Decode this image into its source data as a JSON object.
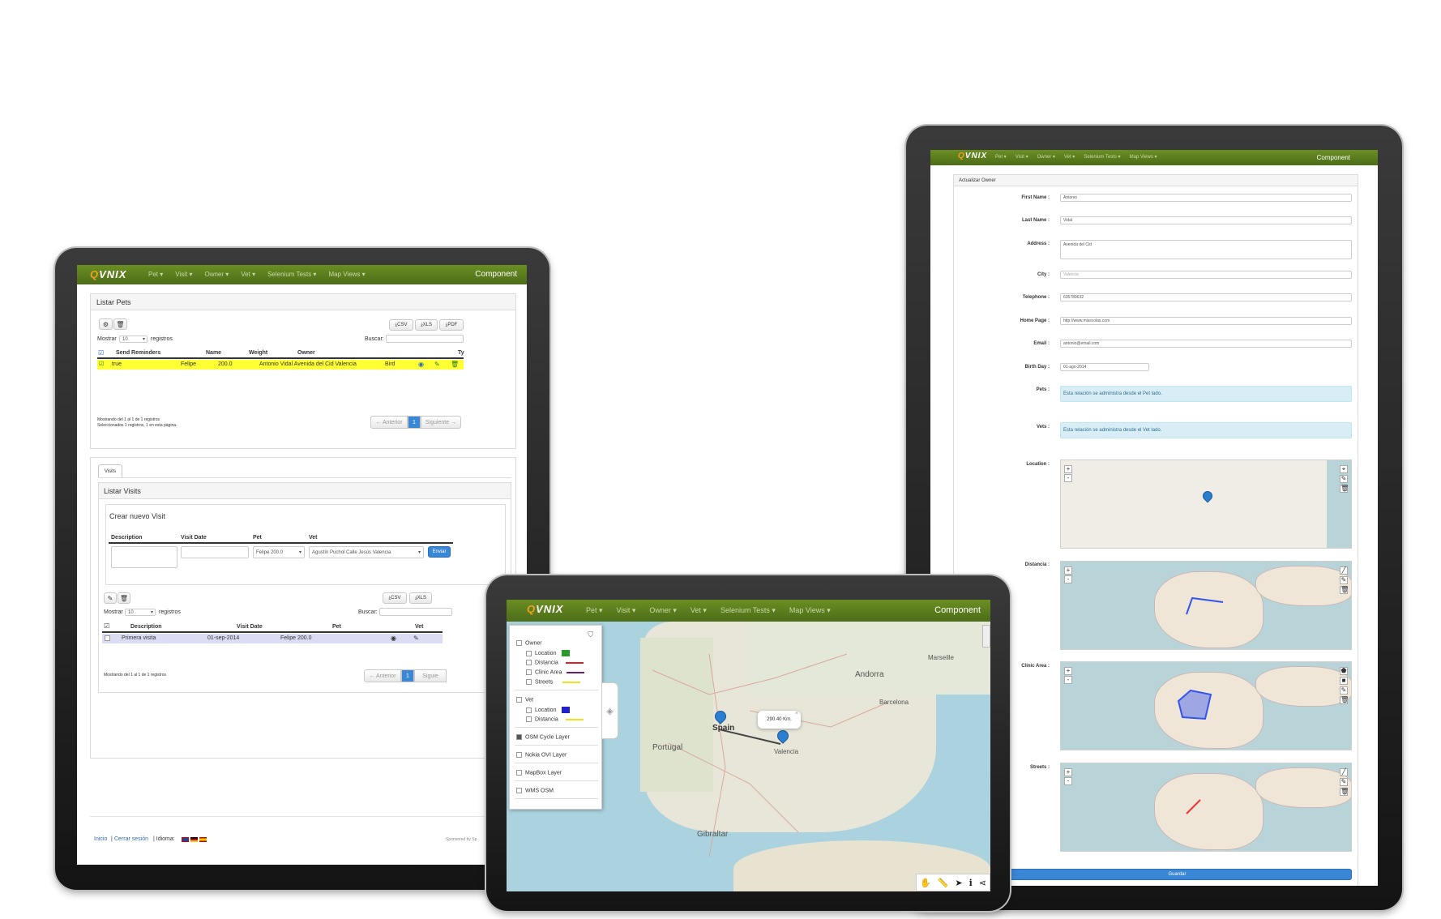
{
  "navbar": {
    "logo_prefix": "Q",
    "logo_text": "VNIX",
    "menus": [
      "Pet ▾",
      "Visit ▾",
      "Owner ▾",
      "Vet ▾",
      "Selenium Tests ▾",
      "Map Views ▾"
    ],
    "brand": "Component"
  },
  "pets": {
    "title": "Listar Pets",
    "export_buttons": [
      "⤓CSV",
      "⤓XLS",
      "⤓PDF"
    ],
    "show_label": "Mostrar",
    "show_value": "10",
    "records_label": "registros",
    "search_label": "Buscar:",
    "columns": [
      "Send Reminders",
      "Name",
      "Weight",
      "Owner",
      "Ty"
    ],
    "rows": [
      {
        "send_reminders": "true",
        "name": "Felipe",
        "weight": "200.0",
        "owner": "Antonio Vidal Avenida del Cid Valencia",
        "type": "Bird"
      }
    ],
    "info_line1": "Mostrando del 1 al 1 de 1 registros",
    "info_line2": "Seleccionados 1 registros, 1 en esta página.",
    "prev": "← Anterior",
    "page": "1",
    "next": "Siguiente →"
  },
  "visits": {
    "tab": "Visits",
    "title": "Listar Visits",
    "create_title": "Crear nuevo Visit",
    "form_labels": [
      "Description",
      "Visit Date",
      "Pet",
      "Vet"
    ],
    "pet_value": "Felipe 200.0",
    "vet_value": "Agustín Puchol Calle Jesús Valencia",
    "submit": "Enviar",
    "export_buttons": [
      "⤓CSV",
      "⤓XLS"
    ],
    "show_label": "Mostrar",
    "show_value": "10",
    "records_label": "registros",
    "search_label": "Buscar:",
    "columns": [
      "Description",
      "Visit Date",
      "Pet",
      "Vet"
    ],
    "rows": [
      {
        "description": "Primera visita",
        "visit_date": "01-sep-2014",
        "pet": "Felipe 200.0"
      }
    ],
    "info_line": "Mostrando del 1 al 1 de 1 registros",
    "prev": "← Anterior",
    "page": "1",
    "next": "Siguie"
  },
  "footer": {
    "inicio": "Inicio",
    "sep1": "|",
    "logout": "Cerrar sesión",
    "idioma": "| Idioma:",
    "sponsored": "Sponsored by Sp"
  },
  "owner_form": {
    "title": "Actualizar Owner",
    "fields": [
      {
        "label": "First Name :",
        "value": "Antonio"
      },
      {
        "label": "Last Name :",
        "value": "Vidal"
      },
      {
        "label": "Address :",
        "value": "Avenida del Cid"
      },
      {
        "label": "City :",
        "value": "Valencia"
      },
      {
        "label": "Telephone :",
        "value": "635789632"
      },
      {
        "label": "Home Page :",
        "value": "http://www.misscolas.com"
      },
      {
        "label": "Email :",
        "value": "antonio@email.com"
      },
      {
        "label": "Birth Day :",
        "value": "01-ago-2014"
      }
    ],
    "pets_label": "Pets :",
    "pets_note": "Esta relación se administra desde el Pet lado.",
    "vets_label": "Vets :",
    "vets_note": "Esta relación se administra desde el Vet lado.",
    "map_labels": [
      "Location :",
      "Distancia :",
      "Clinic Area :",
      "Streets :"
    ],
    "save": "Guardar"
  },
  "map_view": {
    "layers": {
      "owner": "Owner",
      "owner_items": [
        "Location",
        "Distancia",
        "Clinic Area",
        "Streets"
      ],
      "vet": "Vet",
      "vet_items": [
        "Location",
        "Distancia"
      ],
      "base_layers": [
        "OSM Cycle Layer",
        "Nokia OVI Layer",
        "MapBox Layer",
        "WMS OSM"
      ]
    },
    "distance_popup": "290.40 Km.",
    "place_labels": [
      "Andorra",
      "Marseille",
      "Barcelona",
      "Portugal",
      "Gibraltar",
      "Spain",
      "Valencia"
    ]
  },
  "colors": {
    "nav_green": "#5a7d1e",
    "highlight_row": "#ffff33",
    "selected_row": "#dcdcf5",
    "primary_blue": "#3a87d6",
    "info_blue": "#d9edf7"
  }
}
